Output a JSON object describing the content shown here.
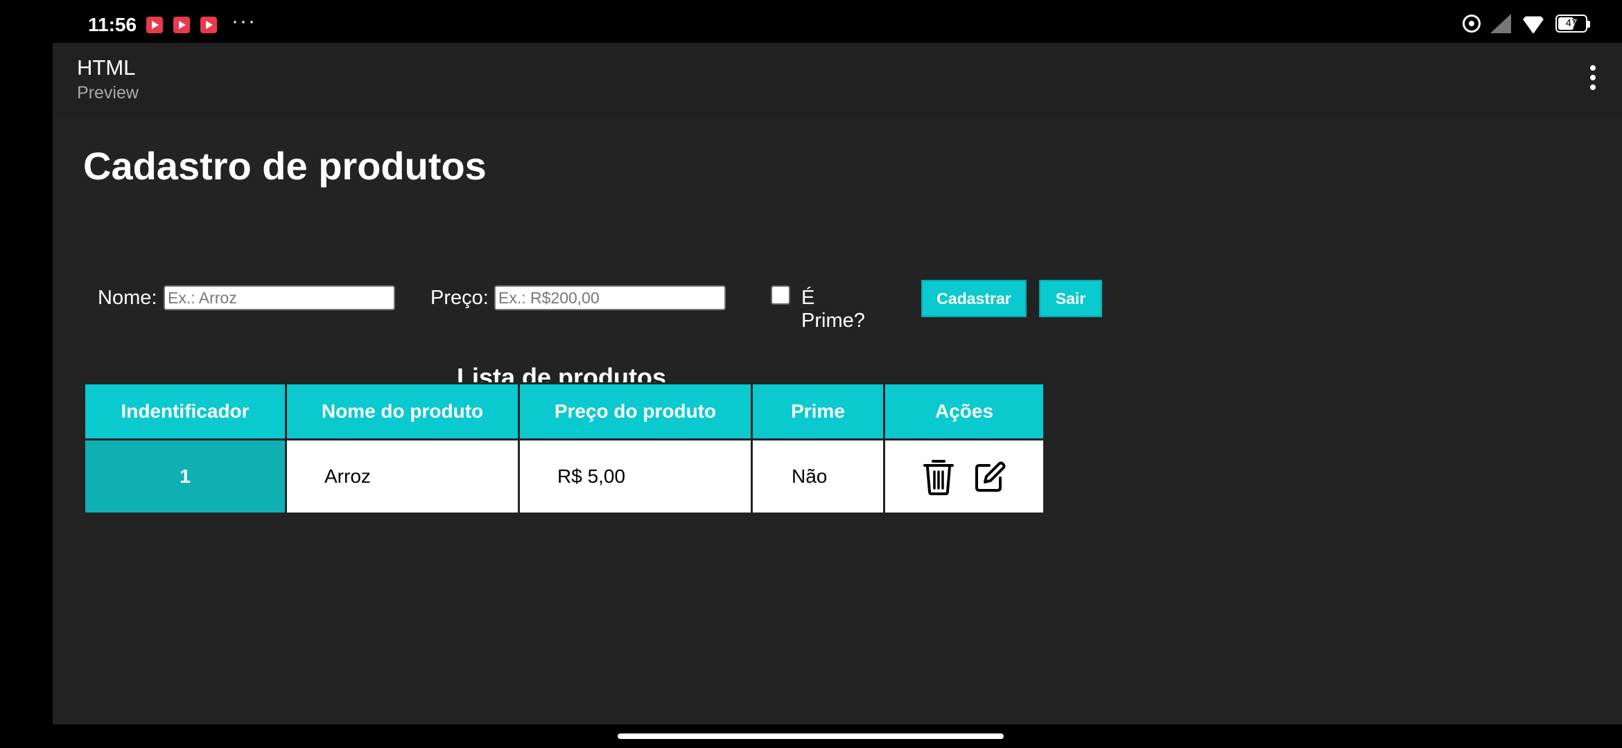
{
  "status_bar": {
    "time": "11:56",
    "notification_icons": [
      "youtube-icon",
      "youtube-icon",
      "youtube-icon"
    ],
    "overflow": "···",
    "battery_level": "47",
    "icons": [
      "alarm-icon",
      "signal-icon",
      "wifi-icon",
      "battery-icon"
    ]
  },
  "app_bar": {
    "title": "HTML",
    "subtitle": "Preview",
    "menu_icon": "more-vert-icon"
  },
  "page": {
    "title": "Cadastro de produtos"
  },
  "form": {
    "name_label": "Nome:",
    "name_placeholder": "Ex.: Arroz",
    "name_value": "",
    "price_label": "Preço:",
    "price_placeholder": "Ex.: R$200,00",
    "price_value": "",
    "prime_label": "É Prime?",
    "prime_checked": false,
    "submit_label": "Cadastrar",
    "exit_label": "Sair"
  },
  "list": {
    "title": "Lista de produtos",
    "columns": [
      "Indentificador",
      "Nome do produto",
      "Preço do produto",
      "Prime",
      "Ações"
    ],
    "rows": [
      {
        "id": "1",
        "name": "Arroz",
        "price": "R$ 5,00",
        "prime": "Não",
        "actions": [
          "trash-icon",
          "edit-icon"
        ]
      }
    ]
  },
  "colors": {
    "accent": "#0ac9cf",
    "id_cell": "#0fb0b2",
    "background": "#232323",
    "app_bar": "#212121"
  }
}
